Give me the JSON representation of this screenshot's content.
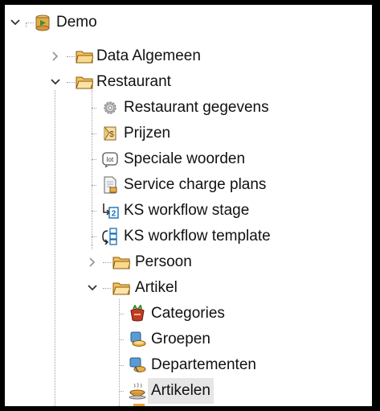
{
  "tree": {
    "root": {
      "label": "Demo",
      "icon": "database-project-icon",
      "expanded": true
    },
    "items": [
      {
        "label": "Data Algemeen",
        "icon": "folder-icon",
        "expanded": false,
        "level": 1
      },
      {
        "label": "Restaurant",
        "icon": "folder-open-icon",
        "expanded": true,
        "level": 1
      },
      {
        "label": "Restaurant gegevens",
        "icon": "gear-icon",
        "level": 2
      },
      {
        "label": "Prijzen",
        "icon": "price-tag-icon",
        "level": 2
      },
      {
        "label": "Speciale woorden",
        "icon": "lot-icon",
        "level": 2
      },
      {
        "label": "Service charge plans",
        "icon": "document-icon",
        "level": 2
      },
      {
        "label": "KS workflow stage",
        "icon": "workflow-stage-icon",
        "level": 2
      },
      {
        "label": "KS workflow template",
        "icon": "workflow-template-icon",
        "level": 2
      },
      {
        "label": "Persoon",
        "icon": "folder-icon",
        "expanded": false,
        "level": 2
      },
      {
        "label": "Artikel",
        "icon": "folder-open-icon",
        "expanded": true,
        "level": 2
      },
      {
        "label": "Categories",
        "icon": "categories-icon",
        "level": 3
      },
      {
        "label": "Groepen",
        "icon": "groups-icon",
        "level": 3
      },
      {
        "label": "Departementen",
        "icon": "departments-icon",
        "level": 3
      },
      {
        "label": "Artikelen",
        "icon": "dish-icon",
        "level": 3,
        "selected": true
      }
    ]
  },
  "colors": {
    "background": "#ffffff",
    "frame": "#000000",
    "folder": "#e8a33a",
    "selection": "#e6e6e6"
  }
}
